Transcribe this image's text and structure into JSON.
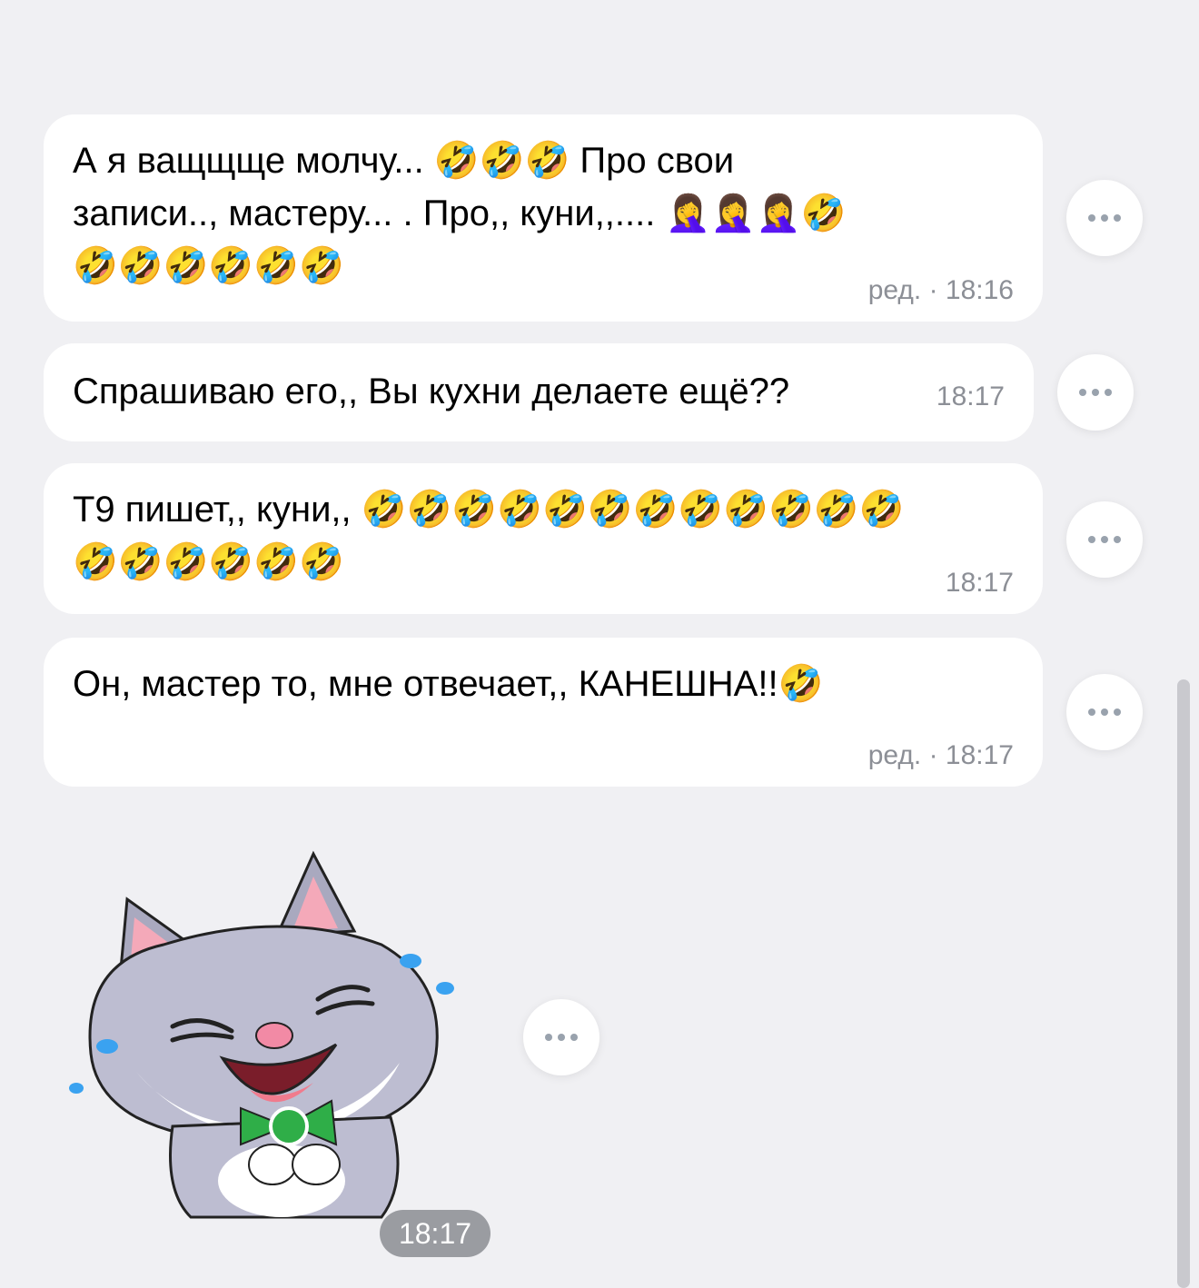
{
  "messages": [
    {
      "text_lines": [
        "А я ващщще молчу... 🤣🤣🤣 Про свои",
        "записи.., мастеру... . Про,, куни,,.... 🤦‍♀️🤦‍♀️🤦‍♀️🤣",
        "🤣🤣🤣🤣🤣🤣"
      ],
      "meta": "ред. · 18:16"
    },
    {
      "text_lines": [
        "Спрашиваю его,, Вы кухни делаете ещё??"
      ],
      "meta": "18:17"
    },
    {
      "text_lines": [
        "Т9 пишет,, куни,, 🤣🤣🤣🤣🤣🤣🤣🤣🤣🤣🤣🤣",
        "🤣🤣🤣🤣🤣🤣"
      ],
      "meta": "18:17"
    },
    {
      "text_lines": [
        "Он, мастер то, мне отвечает,, КАНЕШНА!!🤣"
      ],
      "meta": "ред. · 18:17"
    }
  ],
  "sticker": {
    "icon": "laughing-cat-sticker",
    "time": "18:17"
  },
  "colors": {
    "background": "#f0f0f3",
    "bubble": "#ffffff",
    "meta_text": "#8c8f96",
    "time_pill": "#9a9ca1"
  }
}
